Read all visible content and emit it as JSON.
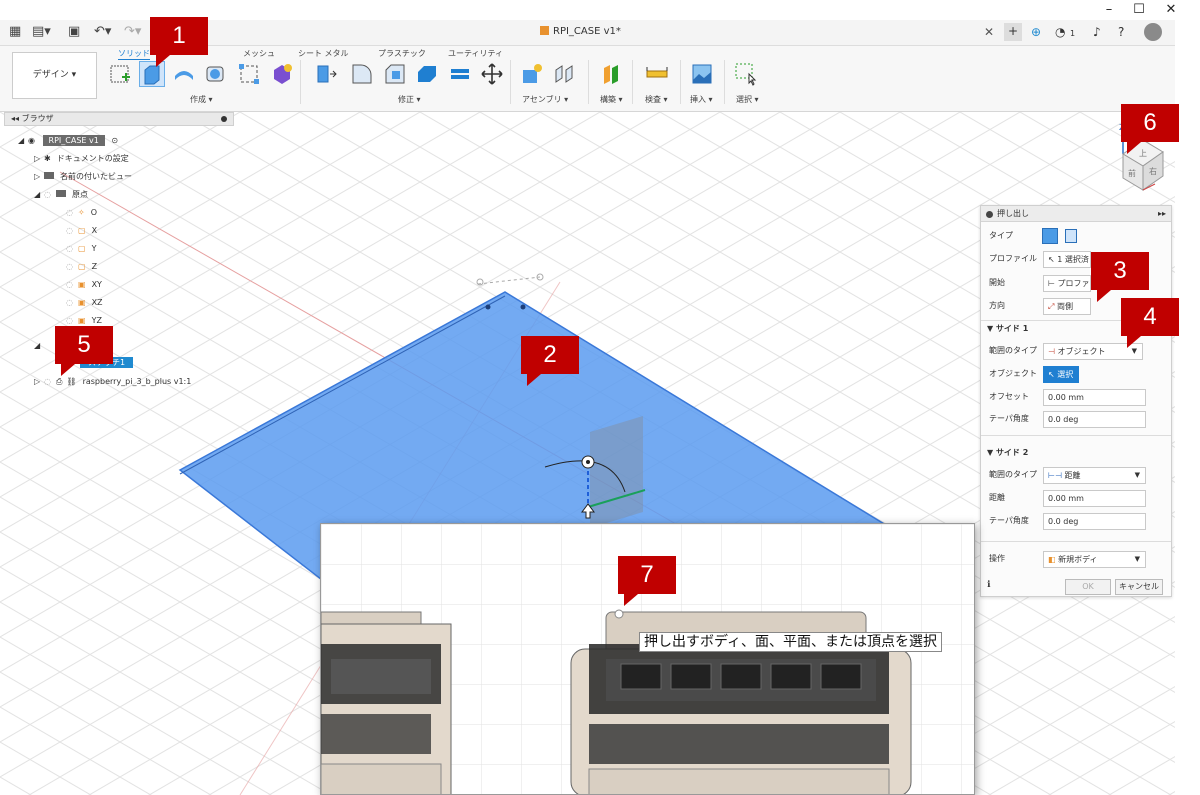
{
  "window": {
    "minimize": "–",
    "maximize": "☐",
    "close": "✕"
  },
  "appbar": {
    "document_tab": "RPI_CASE v1*",
    "tab_close": "✕",
    "new_tab": "+",
    "job_count": "1"
  },
  "ribbon": {
    "workspace_button": "デザイン ▾",
    "tabs": [
      "ソリッド",
      "メッシュ",
      "シート メタル",
      "プラスチック",
      "ユーティリティ"
    ],
    "groups": [
      "作成 ▾",
      "修正 ▾",
      "アセンブリ ▾",
      "構築 ▾",
      "検査 ▾",
      "挿入 ▾",
      "選択 ▾"
    ]
  },
  "browser": {
    "title": "ブラウザ",
    "collapse": "◂◂",
    "root": "RPI_CASE v1",
    "items": [
      {
        "label": "ドキュメントの設定"
      },
      {
        "label": "名前の付いたビュー"
      },
      {
        "label": "原点"
      },
      {
        "label": "O"
      },
      {
        "label": "X"
      },
      {
        "label": "Y"
      },
      {
        "label": "Z"
      },
      {
        "label": "XY"
      },
      {
        "label": "XZ"
      },
      {
        "label": "YZ"
      }
    ],
    "sketch_label": "スケッチ1",
    "component": "raspberry_pi_3_b_plus v1:1"
  },
  "dialog": {
    "title": "押し出し",
    "expand": "▸▸",
    "type_label": "タイプ",
    "profile_label": "プロファイル",
    "profile_value": "1 選択済",
    "start_label": "開始",
    "start_value": "プロファイル",
    "direction_label": "方向",
    "direction_value": "両側",
    "side1": "▼ サイド 1",
    "extent_type_label": "範囲のタイプ",
    "extent1_value": "オブジェクト",
    "object_label": "オブジェクト",
    "object_button": "選択",
    "offset_label": "オフセット",
    "offset_value": "0.00 mm",
    "taper1_label": "テーパ角度",
    "taper1_value": "0.0 deg",
    "side2": "▼ サイド 2",
    "extent2_label": "範囲のタイプ",
    "extent2_value": "距離",
    "distance_label": "距離",
    "distance_value": "0.00 mm",
    "taper2_label": "テーパ角度",
    "taper2_value": "0.0 deg",
    "operation_label": "操作",
    "operation_value": "新規ボディ",
    "ok": "OK",
    "cancel": "キャンセル",
    "info": "ℹ"
  },
  "viewcube": {
    "top": "上",
    "front": "前",
    "right": "右",
    "axis_z": "Z"
  },
  "inset": {
    "tooltip": "押し出すボディ、面、平面、または頂点を選択"
  },
  "callouts": [
    "1",
    "2",
    "3",
    "4",
    "5",
    "6",
    "7"
  ],
  "colors": {
    "callout": "#c00000",
    "selection_blue": "#3f8bf0",
    "accent": "#1f7fd1"
  }
}
